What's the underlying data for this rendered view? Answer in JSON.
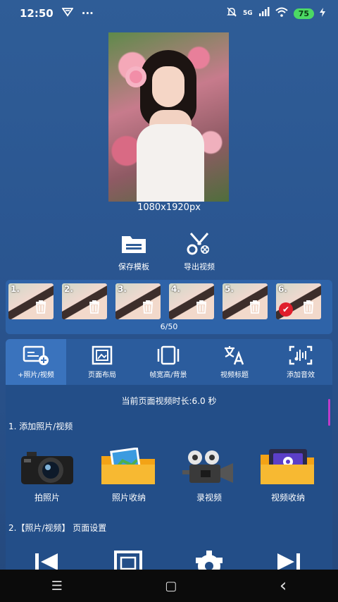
{
  "status_bar": {
    "time": "12:50",
    "extra": "···",
    "network": "5G",
    "battery": "75"
  },
  "preview": {
    "resolution": "1080x1920px"
  },
  "actions": [
    {
      "label": "保存模板",
      "icon": "folder-icon"
    },
    {
      "label": "导出视频",
      "icon": "scissors-icon"
    }
  ],
  "thumbnails": {
    "items": [
      {
        "num": "1."
      },
      {
        "num": "2."
      },
      {
        "num": "3."
      },
      {
        "num": "4."
      },
      {
        "num": "5."
      },
      {
        "num": "6."
      }
    ],
    "count": "6/50"
  },
  "tabs": [
    {
      "label": "+照片/视频",
      "icon": "add-media-icon"
    },
    {
      "label": "页面布局",
      "icon": "layout-icon"
    },
    {
      "label": "帧宽高/背景",
      "icon": "frame-icon"
    },
    {
      "label": "视频标题",
      "icon": "translate-icon"
    },
    {
      "label": "添加音效",
      "icon": "audio-icon"
    }
  ],
  "content": {
    "duration": "当前页面视频时长:6.0 秒",
    "section1_title": "1.  添加照片/视频",
    "media_buttons": [
      {
        "label": "拍照片",
        "icon": "camera-icon"
      },
      {
        "label": "照片收纳",
        "icon": "photo-folder-icon"
      },
      {
        "label": "录视频",
        "icon": "film-camera-icon"
      },
      {
        "label": "视频收纳",
        "icon": "video-folder-icon"
      }
    ],
    "section2_title": "2.【照片/视频】 页面设置"
  },
  "navbar": {
    "menu": "☰",
    "home": "▢",
    "back": "‹"
  }
}
